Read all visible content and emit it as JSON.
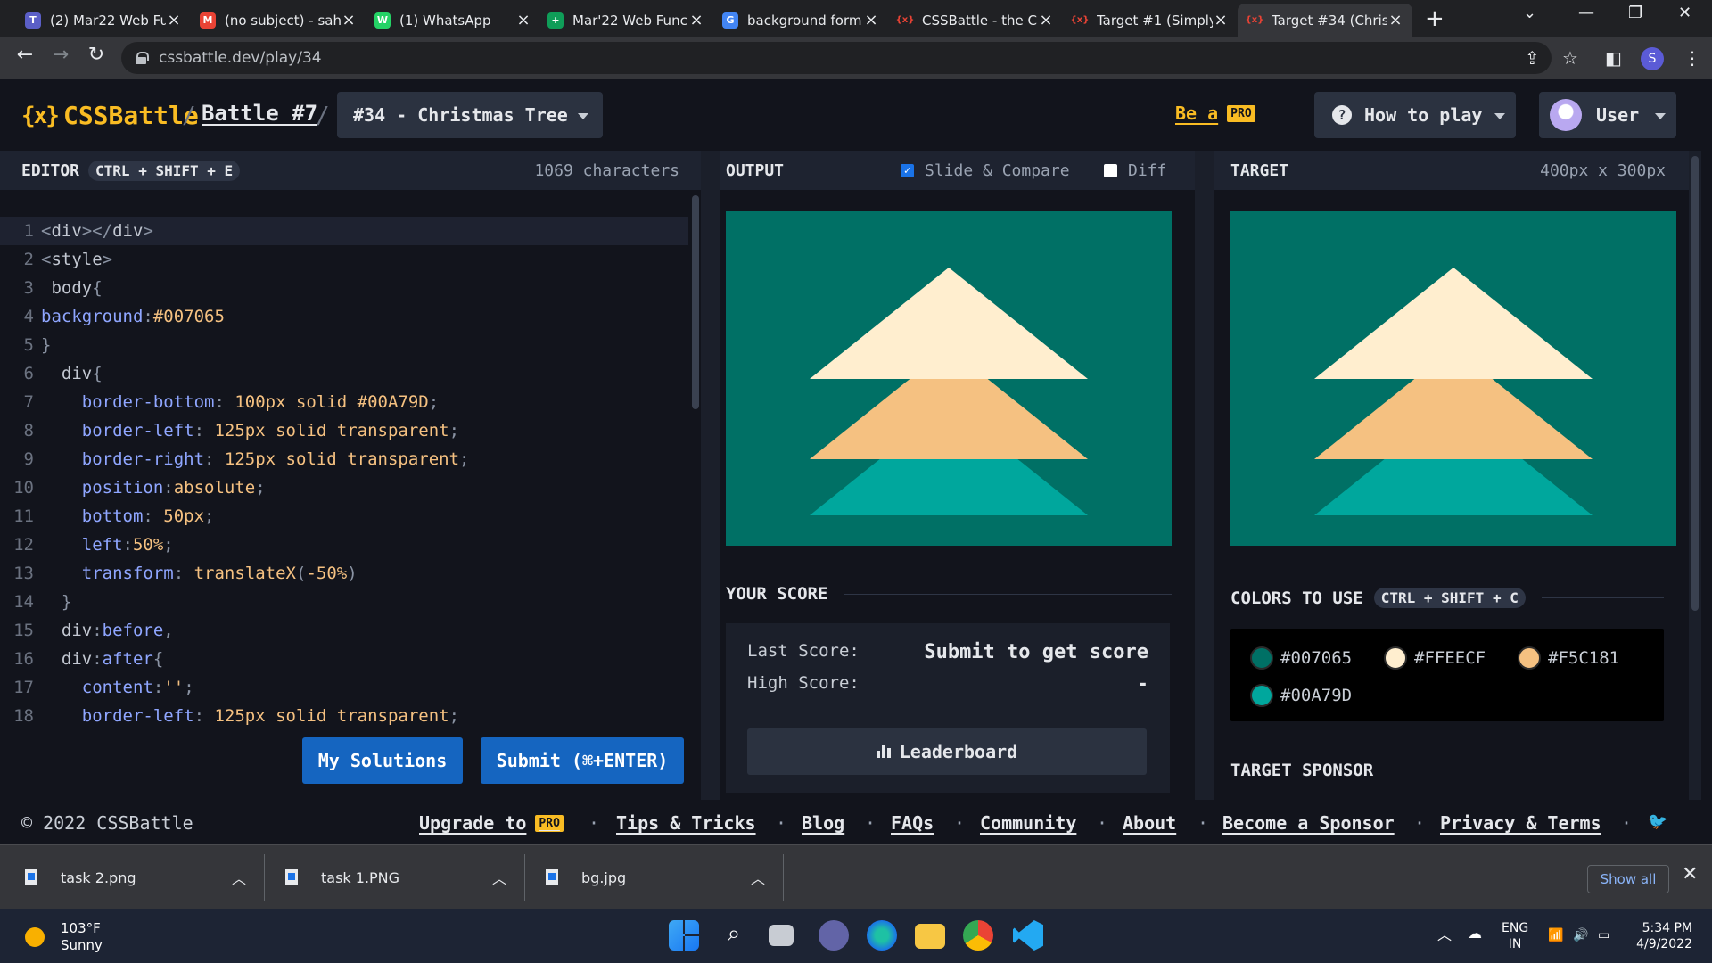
{
  "browser": {
    "tabs": [
      {
        "title": "(2) Mar22 Web Fu",
        "fav_color": "#5b5fc7",
        "fav": "T",
        "active": false
      },
      {
        "title": "(no subject) - sah",
        "fav_color": "#ea4335",
        "fav": "M",
        "active": false
      },
      {
        "title": "(1) WhatsApp",
        "fav_color": "#25d366",
        "fav": "W",
        "active": false
      },
      {
        "title": "Mar'22 Web Func",
        "fav_color": "#0f9d58",
        "fav": "+",
        "active": false
      },
      {
        "title": "background form",
        "fav_color": "#4285f4",
        "fav": "G",
        "active": false
      },
      {
        "title": "CSSBattle - the C",
        "fav_color": "#202124",
        "fav": "{x}",
        "active": false
      },
      {
        "title": "Target #1 (Simply",
        "fav_color": "#202124",
        "fav": "{x}",
        "active": false
      },
      {
        "title": "Target #34 (Christ",
        "fav_color": "#35363a",
        "fav": "{x}",
        "active": true
      }
    ],
    "url": "cssbattle.dev/play/34",
    "profile_initial": "S"
  },
  "header": {
    "logo": "CSSBattle",
    "logo_mark": "{x}",
    "sep": "/",
    "battle": "Battle #7",
    "target_select": "#34 - Christmas Tree",
    "be_a": "Be a",
    "pro": "PRO",
    "how_to_play": "How to play",
    "user": "User"
  },
  "editor": {
    "label": "EDITOR",
    "shortcut": "CTRL + SHIFT + E",
    "char_count": "1069 characters",
    "lines": [
      {
        "n": "1",
        "parts": [
          [
            "pu",
            "<"
          ],
          [
            "t",
            "div"
          ],
          [
            "pu",
            "></"
          ],
          [
            "t",
            "div"
          ],
          [
            "pu",
            ">"
          ]
        ]
      },
      {
        "n": "2",
        "parts": [
          [
            "pu",
            "<"
          ],
          [
            "t",
            "style"
          ],
          [
            "pu",
            ">"
          ]
        ]
      },
      {
        "n": "3",
        "parts": [
          [
            "t",
            " body"
          ],
          [
            "pu",
            "{"
          ]
        ]
      },
      {
        "n": "4",
        "parts": [
          [
            "p",
            "background"
          ],
          [
            "pu",
            ":"
          ],
          [
            "v",
            "#007065"
          ]
        ]
      },
      {
        "n": "5",
        "parts": [
          [
            "pu",
            "}"
          ]
        ]
      },
      {
        "n": "6",
        "parts": [
          [
            "t",
            "  div"
          ],
          [
            "pu",
            "{"
          ]
        ]
      },
      {
        "n": "7",
        "parts": [
          [
            "p",
            "    border-bottom"
          ],
          [
            "pu",
            ": "
          ],
          [
            "v",
            "100px solid #00A79D"
          ],
          [
            "pu",
            ";"
          ]
        ]
      },
      {
        "n": "8",
        "parts": [
          [
            "p",
            "    border-left"
          ],
          [
            "pu",
            ": "
          ],
          [
            "v",
            "125px solid transparent"
          ],
          [
            "pu",
            ";"
          ]
        ]
      },
      {
        "n": "9",
        "parts": [
          [
            "p",
            "    border-right"
          ],
          [
            "pu",
            ": "
          ],
          [
            "v",
            "125px solid transparent"
          ],
          [
            "pu",
            ";"
          ]
        ]
      },
      {
        "n": "10",
        "parts": [
          [
            "p",
            "    position"
          ],
          [
            "pu",
            ":"
          ],
          [
            "v",
            "absolute"
          ],
          [
            "pu",
            ";"
          ]
        ]
      },
      {
        "n": "11",
        "parts": [
          [
            "p",
            "    bottom"
          ],
          [
            "pu",
            ": "
          ],
          [
            "v",
            "50px"
          ],
          [
            "pu",
            ";"
          ]
        ]
      },
      {
        "n": "12",
        "parts": [
          [
            "p",
            "    left"
          ],
          [
            "pu",
            ":"
          ],
          [
            "v",
            "50%"
          ],
          [
            "pu",
            ";"
          ]
        ]
      },
      {
        "n": "13",
        "parts": [
          [
            "p",
            "    transform"
          ],
          [
            "pu",
            ": "
          ],
          [
            "v",
            "translateX"
          ],
          [
            "pu",
            "("
          ],
          [
            "v",
            "-50%"
          ],
          [
            "pu",
            ")"
          ]
        ]
      },
      {
        "n": "14",
        "parts": [
          [
            "pu",
            "  }"
          ]
        ]
      },
      {
        "n": "15",
        "parts": [
          [
            "t",
            "  div"
          ],
          [
            "pu",
            ":"
          ],
          [
            "p",
            "before"
          ],
          [
            "pu",
            ","
          ]
        ]
      },
      {
        "n": "16",
        "parts": [
          [
            "t",
            "  div"
          ],
          [
            "pu",
            ":"
          ],
          [
            "p",
            "after"
          ],
          [
            "pu",
            "{"
          ]
        ]
      },
      {
        "n": "17",
        "parts": [
          [
            "p",
            "    content"
          ],
          [
            "pu",
            ":"
          ],
          [
            "v",
            "''"
          ],
          [
            "pu",
            ";"
          ]
        ]
      },
      {
        "n": "18",
        "parts": [
          [
            "p",
            "    border-left"
          ],
          [
            "pu",
            ": "
          ],
          [
            "v",
            "125px solid transparent"
          ],
          [
            "pu",
            ";"
          ]
        ]
      }
    ],
    "my_solutions": "My Solutions",
    "submit": "Submit (⌘+ENTER)"
  },
  "output": {
    "label": "OUTPUT",
    "slide_compare": "Slide & Compare",
    "slide_checked": true,
    "diff": "Diff",
    "diff_checked": false
  },
  "score": {
    "title": "YOUR SCORE",
    "last_label": "Last Score:",
    "last_value": "Submit to get score",
    "high_label": "High Score:",
    "high_value": "-",
    "leaderboard": "Leaderboard"
  },
  "target": {
    "label": "TARGET",
    "size": "400px x 300px",
    "colors_title": "COLORS TO USE",
    "colors_shortcut": "CTRL + SHIFT + C",
    "colors": [
      "#007065",
      "#FFEECF",
      "#F5C181",
      "#00A79D"
    ],
    "sponsor": "TARGET SPONSOR"
  },
  "footer": {
    "copy": "© 2022 CSSBattle",
    "upgrade": "Upgrade to",
    "pro": "PRO",
    "tips": "Tips & Tricks",
    "blog": "Blog",
    "faqs": "FAQs",
    "community": "Community",
    "about": "About",
    "sponsor": "Become a Sponsor",
    "privacy": "Privacy & Terms",
    "dot": "·"
  },
  "downloads": {
    "items": [
      "task 2.png",
      "task 1.PNG",
      "bg.jpg"
    ],
    "show_all": "Show all"
  },
  "taskbar": {
    "temp": "103°F",
    "weather": "Sunny",
    "lang1": "ENG",
    "lang2": "IN",
    "time": "5:34 PM",
    "date": "4/9/2022"
  }
}
